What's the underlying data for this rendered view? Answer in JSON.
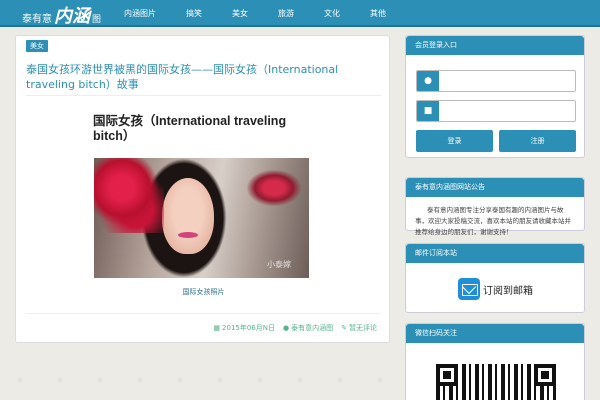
{
  "header": {
    "logo_part1": "泰有意",
    "logo_part2": "内涵",
    "logo_part3": "图",
    "nav": [
      "内涵图片",
      "搞笑",
      "美女",
      "旅游",
      "文化",
      "其他"
    ]
  },
  "article": {
    "category": "美女",
    "title": "泰国女孩环游世界被黑的国际女孩——国际女孩（International traveling bitch）故事",
    "image_heading": "国际女孩（International traveling bitch）",
    "image_watermark": "小泰嫁",
    "caption": "国际女孩照片",
    "meta": {
      "date": "2015年06月N日",
      "author": "泰有意内涵图",
      "comments": "暂无评论"
    }
  },
  "sidebar": {
    "login": {
      "title": "会员登录入口",
      "username_placeholder": "",
      "password_placeholder": "",
      "login_button": "登录",
      "register_button": "注册"
    },
    "notice": {
      "title": "泰有意内涵图网站公告",
      "text": "泰有意内涵图专注分享泰国有趣的内涵图片与故事，欢迎大家投稿交流，喜欢本站的朋友请收藏本站并推荐给身边的朋友们，谢谢支持！"
    },
    "subscribe": {
      "title": "邮件订阅本站",
      "label": "订阅到邮箱"
    },
    "qrcode": {
      "title": "微信扫码关注"
    }
  },
  "colors": {
    "primary": "#2c8fb5",
    "meta_green": "#57b38a"
  }
}
